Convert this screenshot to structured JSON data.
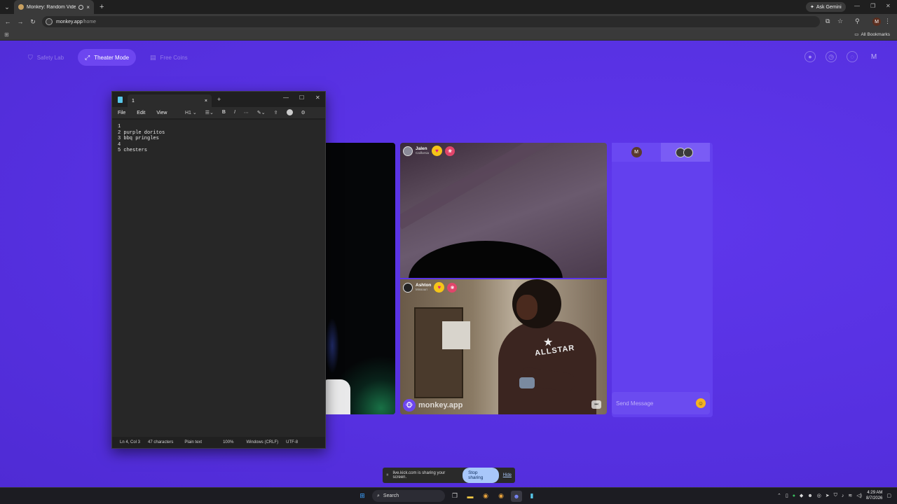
{
  "browser": {
    "tab_title": "Monkey: Random Video Ch",
    "tab_close": "×",
    "new_tab": "+",
    "url_host": "monkey.app",
    "url_path": "/home",
    "gemini_label": "Ask Gemini",
    "all_bookmarks": "All Bookmarks",
    "profile_initial": "M"
  },
  "nav": {
    "items": [
      {
        "label": "Safety Lab",
        "icon": "shield-icon"
      },
      {
        "label": "Theater Mode",
        "icon": "expand-icon"
      },
      {
        "label": "Free Coins",
        "icon": "coins-icon"
      }
    ],
    "profile_initial": "M"
  },
  "videos": {
    "top": {
      "name": "Jalen",
      "location": "California"
    },
    "bottom": {
      "name": "Ashton",
      "location": "Missouri"
    },
    "watermark": "monkey.app",
    "hoodie_text": "ALLSTAR"
  },
  "chat": {
    "tab_avatar": "M",
    "message_placeholder": "Send Message"
  },
  "notepad": {
    "tab_title": "1",
    "menu": [
      "File",
      "Edit",
      "View"
    ],
    "heading_selector": "H1",
    "lines": [
      "1",
      "2 purple doritos",
      "3 bbq pringles",
      "4",
      "5 chesters"
    ],
    "status": {
      "position": "Ln 4, Col 3",
      "chars": "47 characters",
      "format": "Plain text",
      "zoom": "100%",
      "line_ending": "Windows (CRLF)",
      "encoding": "UTF-8"
    }
  },
  "screen_share": {
    "message": "live.kick.com is sharing your screen.",
    "stop_label": "Stop sharing",
    "hide_label": "Hide"
  },
  "taskbar": {
    "search_label": "Search",
    "time": "4:29 AM",
    "date": "8/7/2026"
  }
}
